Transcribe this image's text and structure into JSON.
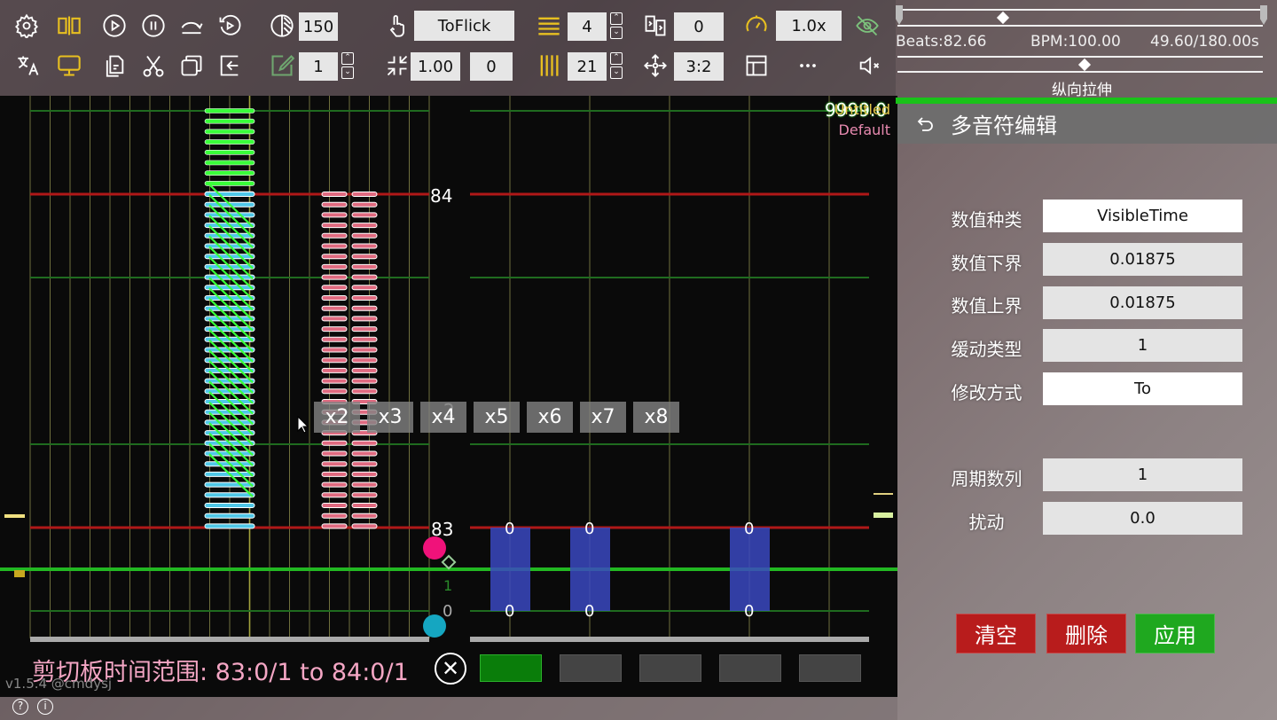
{
  "toolbar": {
    "row1": {
      "icons": [
        "settings-icon",
        "split-view-icon",
        "play-icon",
        "pause-icon",
        "skip-forward-icon",
        "replay-icon"
      ],
      "opacity_value": "150",
      "note_type_value": "ToFlick",
      "lines_value": "4",
      "offset_value": "0",
      "speed_value": "1.0x"
    },
    "row2": {
      "icons": [
        "translate-icon",
        "monitor-icon",
        "paste-icon",
        "cut-icon",
        "copy-icon",
        "import-icon"
      ],
      "edit_value": "1",
      "scale_value": "1.00",
      "scale_offset_value": "0",
      "columns_value": "21",
      "aspect_value": "3:2"
    }
  },
  "timeline": {
    "beats": "Beats:82.66",
    "bpm": "BPM:100.00",
    "time": "49.60/180.00s",
    "playback_progress": 0.27,
    "stretch_position": 0.5,
    "stretch_label": "纵向拉伸"
  },
  "editor": {
    "score_overlay": "9999.0",
    "chart_title": "Untitled",
    "chart_level": "Default",
    "beat_labels": {
      "top": "84",
      "bottom": "83"
    },
    "event_labels": {
      "line_index": "1",
      "zero": "0",
      "ghost": "2"
    },
    "event_values": [
      "0",
      "0",
      "0",
      "0",
      "0",
      "0"
    ],
    "multipliers": [
      "x2",
      "x3",
      "x4",
      "x5",
      "x6",
      "x7",
      "x8"
    ],
    "colors": {
      "measure_line": "#b01818",
      "beat_line": "#1f6b1f",
      "lane_line": "#8a8a4a",
      "current_line": "#22b822",
      "flick_note": "#39ff39",
      "tap_note": "#4fc8e8",
      "hold_note": "#e06a80",
      "event_block": "#3a48c0"
    }
  },
  "clipboard": {
    "label": "剪切板时间范围: 83:0/1 to 84:0/1"
  },
  "version": "v1.5.4 @cmdysj",
  "panel": {
    "title": "多音符编辑",
    "fields": [
      {
        "label": "数值种类",
        "value": "VisibleTime"
      },
      {
        "label": "数值下界",
        "value": "0.01875"
      },
      {
        "label": "数值上界",
        "value": "0.01875"
      },
      {
        "label": "缓动类型",
        "value": "1"
      },
      {
        "label": "修改方式",
        "value": "To"
      },
      {
        "label": "周期数列",
        "value": "1"
      },
      {
        "label": "扰动",
        "value": "0.0"
      }
    ],
    "buttons": {
      "clear": "清空",
      "delete": "删除",
      "apply": "应用"
    },
    "button_colors": {
      "clear": "#b81c1c",
      "delete": "#b81c1c",
      "apply": "#1fa81f"
    }
  },
  "footer": {
    "help": "?",
    "info": "i"
  }
}
